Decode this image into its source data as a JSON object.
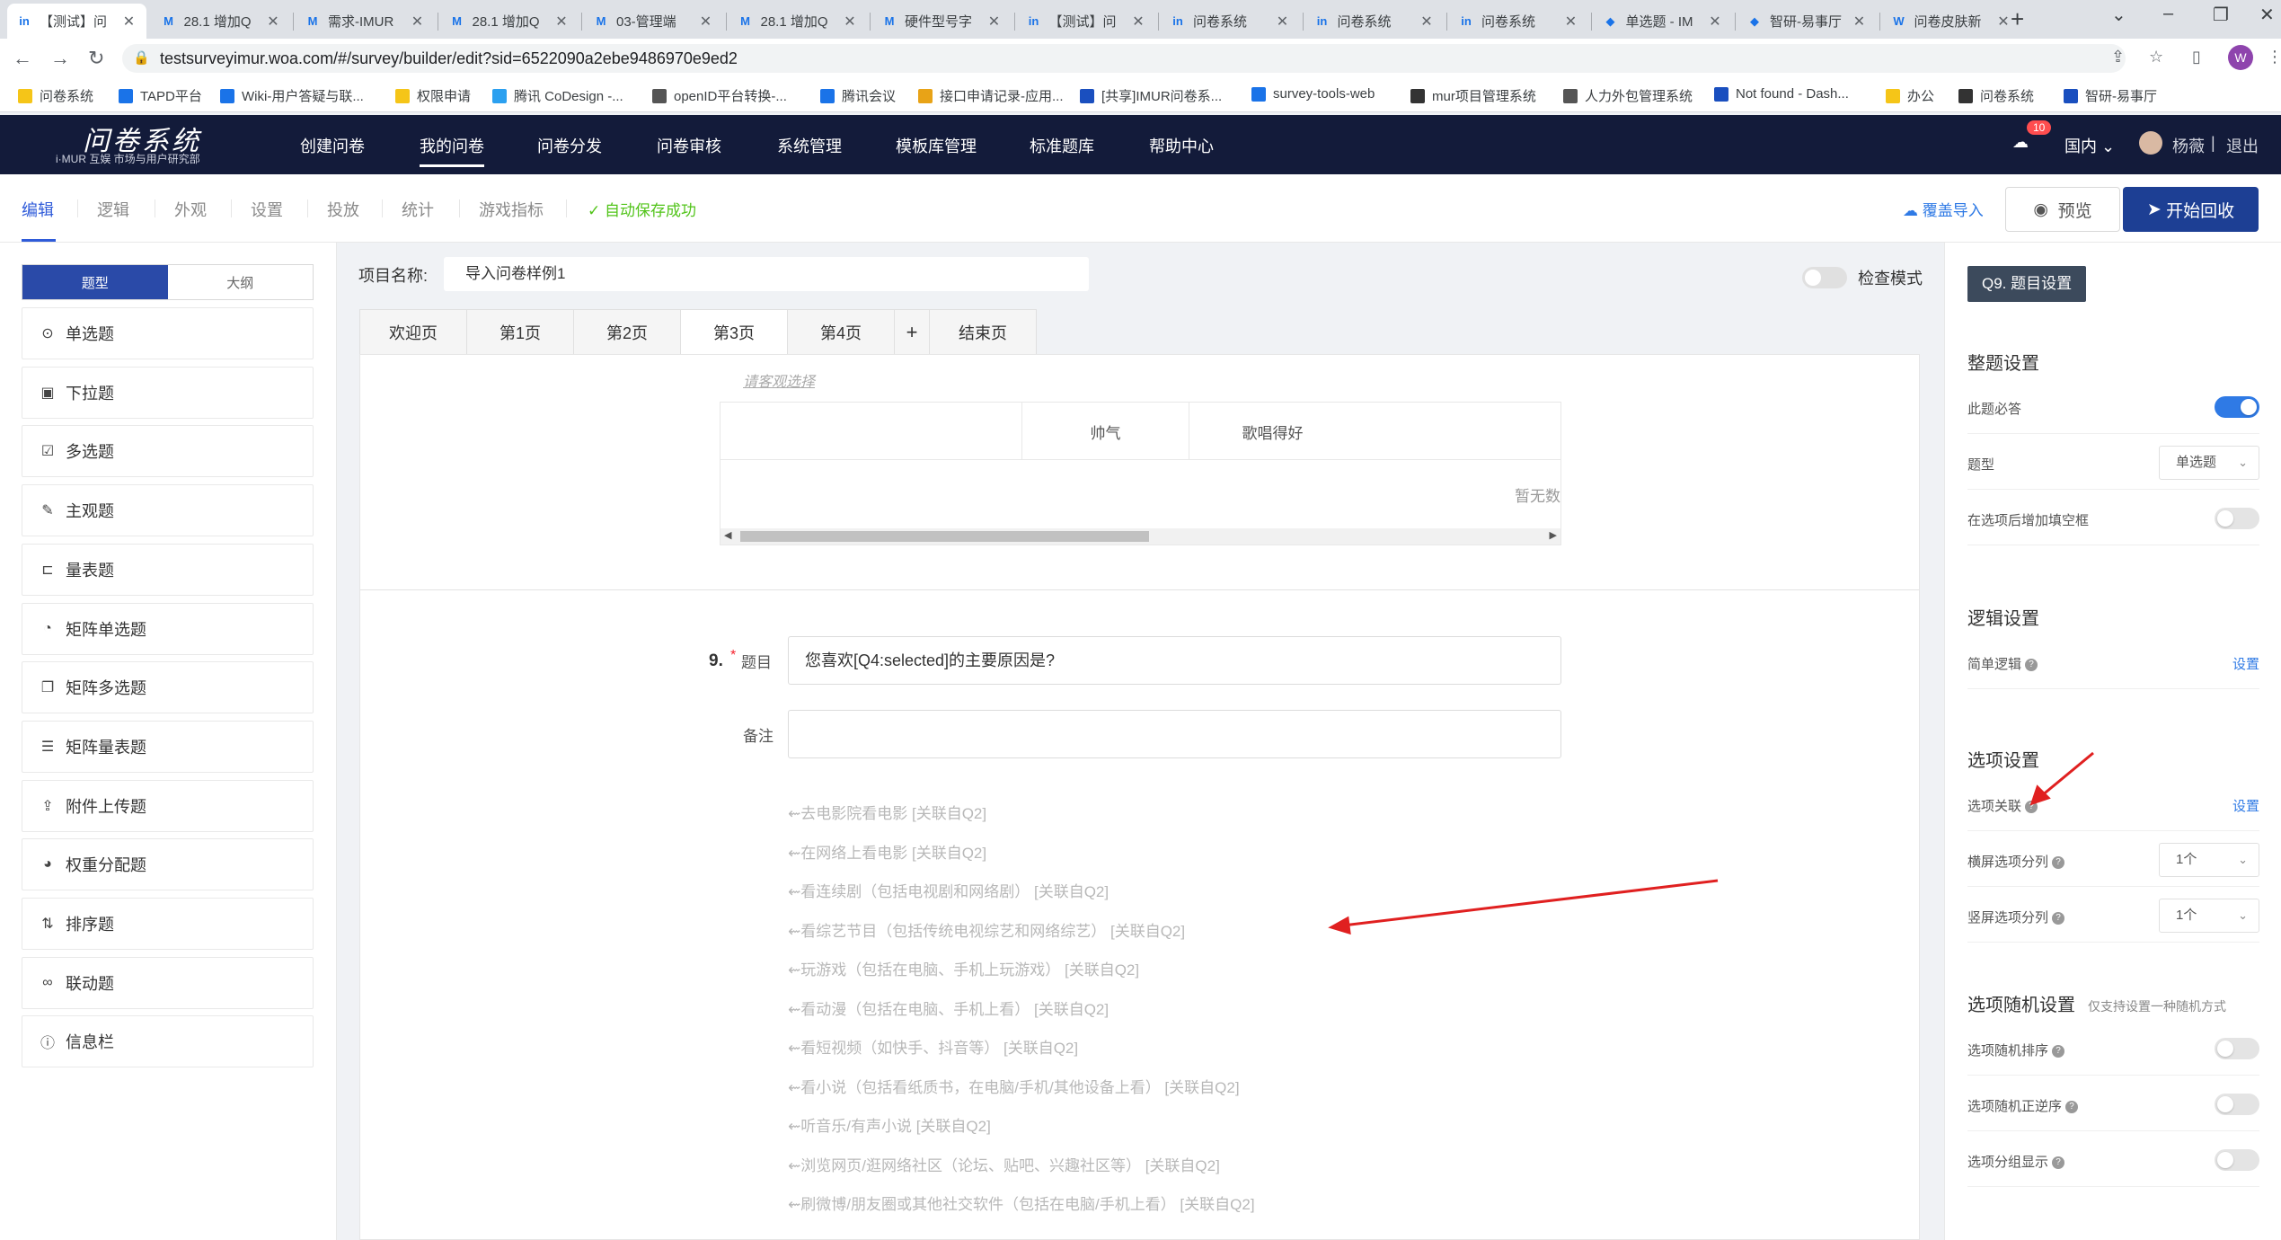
{
  "browser": {
    "tabs": [
      {
        "label": "【测试】问",
        "icon": "in",
        "active": true
      },
      {
        "label": "28.1 增加Q",
        "icon": "M"
      },
      {
        "label": "需求-IMUR",
        "icon": "M"
      },
      {
        "label": "28.1 增加Q",
        "icon": "M"
      },
      {
        "label": "03-管理端",
        "icon": "M"
      },
      {
        "label": "28.1 增加Q",
        "icon": "M"
      },
      {
        "label": "硬件型号字",
        "icon": "M"
      },
      {
        "label": "【测试】问",
        "icon": "in"
      },
      {
        "label": "问卷系统",
        "icon": "in"
      },
      {
        "label": "问卷系统",
        "icon": "in"
      },
      {
        "label": "问卷系统",
        "icon": "in"
      },
      {
        "label": "单选题 - IM",
        "icon": "◆"
      },
      {
        "label": "智研-易事厅",
        "icon": "◆"
      },
      {
        "label": "问卷皮肤新",
        "icon": "W"
      }
    ],
    "url": "testsurveyimur.woa.com/#/survey/builder/edit?sid=6522090a2ebe9486970e9ed2",
    "profile_initial": "W",
    "bookmarks": [
      {
        "label": "问卷系统",
        "color": "#f5c518"
      },
      {
        "label": "TAPD平台",
        "color": "#1a73e8"
      },
      {
        "label": "Wiki-用户答疑与联...",
        "color": "#1a73e8"
      },
      {
        "label": "权限申请",
        "color": "#f5c518"
      },
      {
        "label": "腾讯 CoDesign -...",
        "color": "#2ba0f0"
      },
      {
        "label": "openID平台转换-...",
        "color": "#555555"
      },
      {
        "label": "腾讯会议",
        "color": "#1a73e8"
      },
      {
        "label": "接口申请记录-应用...",
        "color": "#e8a317"
      },
      {
        "label": "[共享]IMUR问卷系...",
        "color": "#1a4fbf"
      },
      {
        "label": "survey-tools-web",
        "color": "#1a73e8"
      },
      {
        "label": "mur项目管理系统",
        "color": "#333333"
      },
      {
        "label": "人力外包管理系统",
        "color": "#555555"
      },
      {
        "label": "Not found - Dash...",
        "color": "#1a4fbf"
      },
      {
        "label": "办公",
        "color": "#f5c518"
      },
      {
        "label": "问卷系统",
        "color": "#333333"
      },
      {
        "label": "智研-易事厅",
        "color": "#1a4fbf"
      }
    ]
  },
  "header": {
    "logo": "问卷系统",
    "logo_sub": "i·MUR 互娱 市场与用户研究部",
    "nav": [
      "创建问卷",
      "我的问卷",
      "问卷分发",
      "问卷审核",
      "系统管理",
      "模板库管理",
      "标准题库",
      "帮助中心"
    ],
    "active_nav": "我的问卷",
    "notification_count": "10",
    "region": "国内",
    "user": "杨薇",
    "logout": "退出"
  },
  "toolbar": {
    "tabs": [
      "编辑",
      "逻辑",
      "外观",
      "设置",
      "投放",
      "统计",
      "游戏指标"
    ],
    "active_tab": "编辑",
    "autosave": "自动保存成功",
    "import_label": "覆盖导入",
    "preview_label": "预览",
    "start_label": "开始回收"
  },
  "left_panel": {
    "segment": [
      "题型",
      "大纲"
    ],
    "question_types": [
      {
        "label": "单选题",
        "icon": "radio-icon"
      },
      {
        "label": "下拉题",
        "icon": "dropdown-icon"
      },
      {
        "label": "多选题",
        "icon": "checkbox-icon"
      },
      {
        "label": "主观题",
        "icon": "pencil-icon"
      },
      {
        "label": "量表题",
        "icon": "scale-icon"
      },
      {
        "label": "矩阵单选题",
        "icon": "matrix-radio-icon"
      },
      {
        "label": "矩阵多选题",
        "icon": "matrix-checkbox-icon"
      },
      {
        "label": "矩阵量表题",
        "icon": "matrix-scale-icon"
      },
      {
        "label": "附件上传题",
        "icon": "upload-icon"
      },
      {
        "label": "权重分配题",
        "icon": "pie-icon"
      },
      {
        "label": "排序题",
        "icon": "sort-icon"
      },
      {
        "label": "联动题",
        "icon": "link-icon"
      },
      {
        "label": "信息栏",
        "icon": "info-icon"
      }
    ]
  },
  "editor": {
    "project_label": "项目名称:",
    "project_name": "导入问卷样例1",
    "check_mode_label": "检查模式",
    "page_tabs": [
      "欢迎页",
      "第1页",
      "第2页",
      "第3页",
      "第4页",
      "+",
      "结束页"
    ],
    "active_page": "第3页",
    "prev_question": {
      "placeholder": "请客观选择",
      "columns": [
        "帅气",
        "歌唱得好"
      ],
      "empty_text": "暂无数"
    },
    "question": {
      "number": "9.",
      "required_mark": "*",
      "title_label": "题目",
      "title_value": "您喜欢[Q4:selected]的主要原因是?",
      "note_label": "备注",
      "note_value": "",
      "options": [
        "去电影院看电影 [关联自Q2]",
        "在网络上看电影 [关联自Q2]",
        "看连续剧（包括电视剧和网络剧） [关联自Q2]",
        "看综艺节目（包括传统电视综艺和网络综艺） [关联自Q2]",
        "玩游戏（包括在电脑、手机上玩游戏） [关联自Q2]",
        "看动漫（包括在电脑、手机上看） [关联自Q2]",
        "看短视频（如快手、抖音等） [关联自Q2]",
        "看小说（包括看纸质书，在电脑/手机/其他设备上看） [关联自Q2]",
        "听音乐/有声小说 [关联自Q2]",
        "浏览网页/逛网络社区（论坛、贴吧、兴趣社区等） [关联自Q2]",
        "刷微博/朋友圈或其他社交软件（包括在电脑/手机上看） [关联自Q2]"
      ]
    }
  },
  "right_panel": {
    "title": "Q9. 题目设置",
    "sections": {
      "whole": "整题设置",
      "logic": "逻辑设置",
      "options": "选项设置",
      "random": "选项随机设置",
      "random_note": "仅支持设置一种随机方式"
    },
    "rows": {
      "required": "此题必答",
      "type": "题型",
      "type_value": "单选题",
      "add_blank": "在选项后增加填空框",
      "simple_logic": "简单逻辑",
      "option_link": "选项关联",
      "landscape_cols": "横屏选项分列",
      "landscape_value": "1个",
      "portrait_cols": "竖屏选项分列",
      "portrait_value": "1个",
      "random_order": "选项随机排序",
      "random_reverse": "选项随机正逆序",
      "group_display": "选项分组显示",
      "set_link": "设置"
    }
  },
  "colors": {
    "header_bg": "#131b3a",
    "primary": "#1d3f94",
    "link": "#2f7ae5",
    "success": "#52c41a",
    "annotation": "#e02020"
  }
}
